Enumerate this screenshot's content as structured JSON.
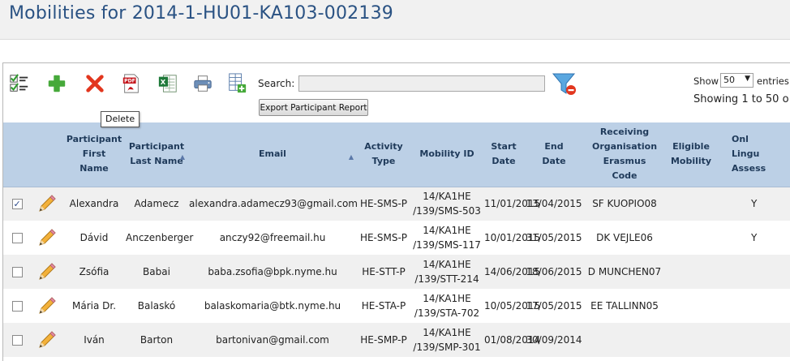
{
  "page": {
    "title": "Mobilities for 2014-1-HU01-KA103-002139"
  },
  "toolbar": {
    "search_label": "Search:",
    "search_value": "",
    "export_label": "Export Participant Report",
    "tooltip": "Delete",
    "show_label": "Show",
    "entries_value": "50",
    "entries_label": "entries",
    "showing_text": "Showing 1 to 50 o"
  },
  "colors": {
    "title": "#2a5283",
    "header_bg": "#bcd0e6",
    "row_alt": "#f0f0f0"
  },
  "table": {
    "headers": {
      "first_name": [
        "Participant",
        "First",
        "Name"
      ],
      "last_name": [
        "Participant",
        "Last Name"
      ],
      "email": [
        "Email"
      ],
      "activity": [
        "Activity",
        "Type"
      ],
      "mobility_id": [
        "Mobility ID"
      ],
      "start": [
        "Start",
        "Date"
      ],
      "end": [
        "End",
        "Date"
      ],
      "org": [
        "Receiving",
        "Organisation",
        "Erasmus",
        "Code"
      ],
      "eligible": [
        "Eligible",
        "Mobility"
      ],
      "ols": [
        "Onl",
        "Lingu",
        "Assess"
      ]
    },
    "rows": [
      {
        "checked": true,
        "first": "Alexandra",
        "last": "Adamecz",
        "email": "alexandra.adamecz93@gmail.com",
        "activity": "HE-SMS-P",
        "mob1": "14/KA1HE",
        "mob2": "/139/SMS-503",
        "start": "11/01/2015",
        "end": "13/04/2015",
        "org": "SF KUOPIO08",
        "eligible": "",
        "ols": "Y"
      },
      {
        "checked": false,
        "first": "Dávid",
        "last": "Anczenberger",
        "email": "anczy92@freemail.hu",
        "activity": "HE-SMS-P",
        "mob1": "14/KA1HE",
        "mob2": "/139/SMS-117",
        "start": "10/01/2015",
        "end": "31/05/2015",
        "org": "DK VEJLE06",
        "eligible": "",
        "ols": "Y"
      },
      {
        "checked": false,
        "first": "Zsófia",
        "last": "Babai",
        "email": "baba.zsofia@bpk.nyme.hu",
        "activity": "HE-STT-P",
        "mob1": "14/KA1HE",
        "mob2": "/139/STT-214",
        "start": "14/06/2015",
        "end": "18/06/2015",
        "org": "D MUNCHEN07",
        "eligible": "",
        "ols": ""
      },
      {
        "checked": false,
        "first": "Mária Dr.",
        "last": "Balaskó",
        "email": "balaskomaria@btk.nyme.hu",
        "activity": "HE-STA-P",
        "mob1": "14/KA1HE",
        "mob2": "/139/STA-702",
        "start": "10/05/2015",
        "end": "17/05/2015",
        "org": "EE TALLINN05",
        "eligible": "",
        "ols": ""
      },
      {
        "checked": false,
        "first": "Iván",
        "last": "Barton",
        "email": "bartonivan@gmail.com",
        "activity": "HE-SMP-P",
        "mob1": "14/KA1HE",
        "mob2": "/139/SMP-301",
        "start": "01/08/2014",
        "end": "30/09/2014",
        "org": "",
        "eligible": "",
        "ols": ""
      }
    ]
  }
}
